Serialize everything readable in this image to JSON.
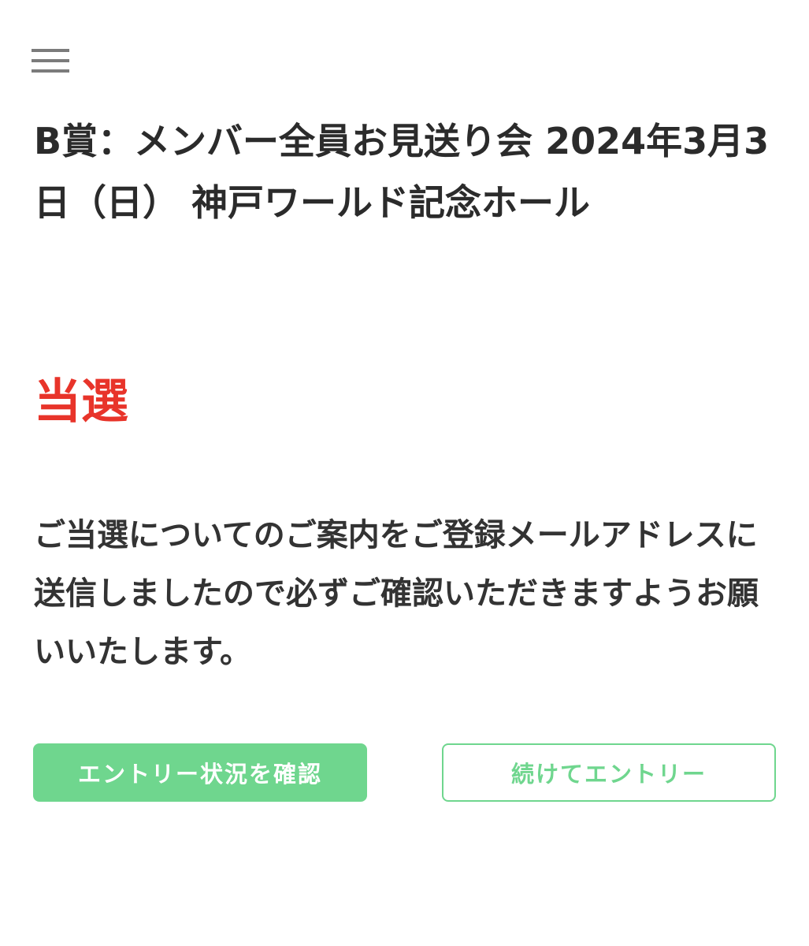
{
  "header": {
    "menu_icon": "hamburger-menu-icon"
  },
  "event": {
    "title": "B賞：メンバー全員お見送り会 2024年3月3日（日） 神戸ワールド記念ホール"
  },
  "result": {
    "label": "当選",
    "color": "#e8342a"
  },
  "message": {
    "text": "ご当選についてのご案内をご登録メールアドレスに送信しましたので必ずご確認いただきますようお願いいたします。"
  },
  "actions": {
    "check_status_label": "エントリー状況を確認",
    "continue_entry_label": "続けてエントリー",
    "accent_color": "#6fd68e"
  }
}
